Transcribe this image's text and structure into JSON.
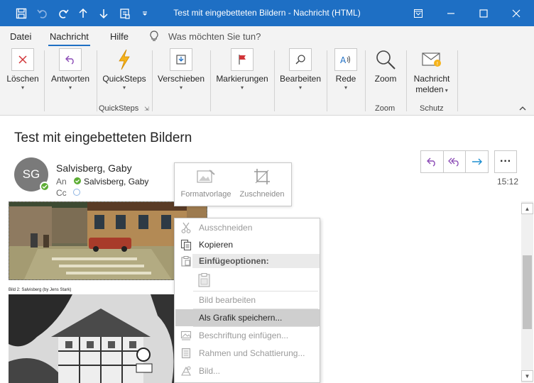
{
  "window": {
    "title": "Test mit eingebetteten Bildern  -  Nachricht (HTML)"
  },
  "menu_tabs": [
    {
      "label": "Datei"
    },
    {
      "label": "Nachricht",
      "active": true
    },
    {
      "label": "Hilfe"
    },
    {
      "label": "Was möchten Sie tun?"
    }
  ],
  "ribbon": {
    "delete": "Löschen",
    "reply": "Antworten",
    "quicksteps": "QuickSteps",
    "move": "Verschieben",
    "tags": "Markierungen",
    "editing": "Bearbeiten",
    "speech": "Rede",
    "zoom": "Zoom",
    "report_line1": "Nachricht",
    "report_line2": "melden",
    "group_quicksteps": "QuickSteps",
    "group_zoom": "Zoom",
    "group_protect": "Schutz"
  },
  "message": {
    "subject": "Test mit eingebetteten Bildern",
    "avatar_initials": "SG",
    "sender": "Salvisberg, Gaby",
    "to_label": "An",
    "to_value": "Salvisberg, Gaby",
    "cc_label": "Cc",
    "time": "15:12",
    "caption": "Bild 2: Salvisberg (by Jens Stark)"
  },
  "mini_toolbar": {
    "style": "Formatvorlage",
    "crop": "Zuschneiden"
  },
  "context_menu": {
    "cut": "Ausschneiden",
    "copy": "Kopieren",
    "paste_options": "Einfügeoptionen:",
    "edit_image": "Bild bearbeiten",
    "save_as_image": "Als Grafik speichern...",
    "insert_caption": "Beschriftung einfügen...",
    "borders_shading": "Rahmen und Schattierung...",
    "picture": "Bild..."
  },
  "colors": {
    "accent": "#1e6fc4",
    "presence": "#5dad34",
    "flag": "#d13438"
  }
}
